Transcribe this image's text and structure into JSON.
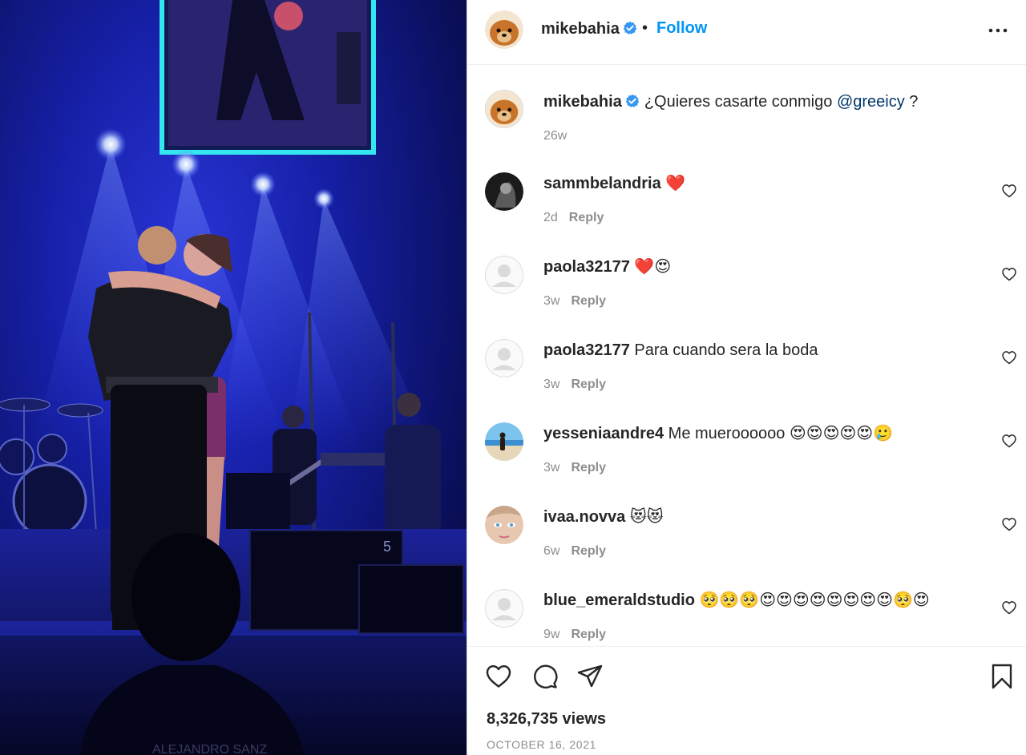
{
  "post": {
    "username": "mikebahia",
    "verified": true,
    "follow_label": "Follow",
    "dot": "•",
    "more_icon": "more-horizontal-icon",
    "caption": {
      "username": "mikebahia",
      "text_before": "¿Quieres casarte conmigo ",
      "mention": "@greeicy",
      "text_after": " ?",
      "time": "26w"
    },
    "views": "8,326,735 views",
    "date": "OCTOBER 16, 2021"
  },
  "colors": {
    "accent": "#0095f6",
    "verified": "#3897f0",
    "mention": "#00376b",
    "muted": "#8e8e8e",
    "heart": "#ed1c24"
  },
  "comments": [
    {
      "username": "sammbelandria",
      "text": "",
      "emojis": "❤️",
      "time": "2d",
      "reply": "Reply"
    },
    {
      "username": "paola32177",
      "text": "",
      "emojis": "❤️😍",
      "time": "3w",
      "reply": "Reply"
    },
    {
      "username": "paola32177",
      "text": "Para cuando sera la boda",
      "emojis": "",
      "time": "3w",
      "reply": "Reply"
    },
    {
      "username": "yesseniaandre4",
      "text": "Me mueroooooo",
      "emojis": "😍😍😍😍😍🥲",
      "time": "3w",
      "reply": "Reply"
    },
    {
      "username": "ivaa.novva",
      "text": "",
      "emojis": "😻😻",
      "time": "6w",
      "reply": "Reply"
    },
    {
      "username": "blue_emeraldstudio",
      "text": "",
      "emojis": "🥺🥺🥺😍😍😍😍😍😍😍😍🥺😍",
      "time": "9w",
      "reply": "Reply"
    }
  ],
  "actions": {
    "like_icon": "heart-icon",
    "comment_icon": "comment-icon",
    "share_icon": "send-icon",
    "save_icon": "bookmark-icon"
  }
}
